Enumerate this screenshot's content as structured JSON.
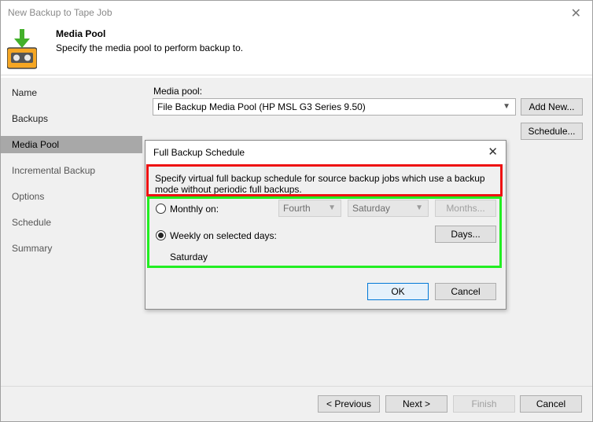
{
  "window": {
    "title": "New Backup to Tape Job"
  },
  "header": {
    "title": "Media Pool",
    "subtitle": "Specify the media pool to perform backup to."
  },
  "sidebar": {
    "items": [
      {
        "label": "Name"
      },
      {
        "label": "Backups"
      },
      {
        "label": "Media Pool"
      },
      {
        "label": "Incremental Backup"
      },
      {
        "label": "Options"
      },
      {
        "label": "Schedule"
      },
      {
        "label": "Summary"
      }
    ],
    "active_index": 2
  },
  "main": {
    "media_pool_label": "Media pool:",
    "media_pool_value": "File Backup Media Pool (HP MSL G3 Series 9.50)",
    "add_new_label": "Add New...",
    "schedule_label": "Schedule..."
  },
  "dialog": {
    "title": "Full Backup Schedule",
    "description": "Specify virtual full backup schedule for source backup jobs which use a backup mode without periodic full backups.",
    "monthly_label": "Monthly on:",
    "monthly_week": "Fourth",
    "monthly_day": "Saturday",
    "months_button": "Months...",
    "weekly_label": "Weekly on selected days:",
    "days_button": "Days...",
    "selected_days": "Saturday",
    "ok_label": "OK",
    "cancel_label": "Cancel",
    "weekly_selected": true
  },
  "footer": {
    "previous_label": "< Previous",
    "next_label": "Next >",
    "finish_label": "Finish",
    "cancel_label": "Cancel"
  },
  "colors": {
    "highlight_red": "#ee1111",
    "highlight_green": "#22ee22",
    "primary_border": "#0078d7"
  }
}
